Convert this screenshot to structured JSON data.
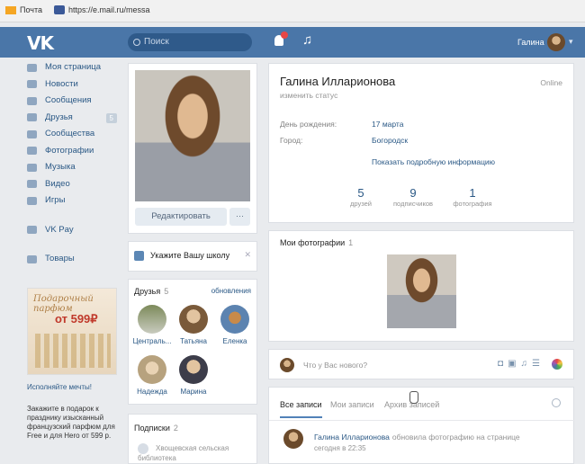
{
  "browser": {
    "tabs": [
      {
        "label": "Почта"
      },
      {
        "label": "https://e.mail.ru/messa"
      }
    ]
  },
  "header": {
    "logo": "VK",
    "search_placeholder": "Поиск",
    "user_name": "Галина",
    "accent_color": "#4a76a8"
  },
  "sidebar": {
    "items": [
      {
        "label": "Моя страница",
        "icon": "home-icon"
      },
      {
        "label": "Новости",
        "icon": "news-icon"
      },
      {
        "label": "Сообщения",
        "icon": "messages-icon"
      },
      {
        "label": "Друзья",
        "icon": "friends-icon",
        "badge": "5"
      },
      {
        "label": "Сообщества",
        "icon": "communities-icon"
      },
      {
        "label": "Фотографии",
        "icon": "photo-icon"
      },
      {
        "label": "Музыка",
        "icon": "music-icon"
      },
      {
        "label": "Видео",
        "icon": "video-icon"
      },
      {
        "label": "Игры",
        "icon": "games-icon"
      }
    ],
    "extra": [
      {
        "label": "VK Pay",
        "icon": "vkpay-icon"
      },
      {
        "label": "Товары",
        "icon": "goods-icon"
      }
    ]
  },
  "ad": {
    "image_text": "Подарочный парфюм",
    "price": "от 599₽",
    "title": "Исполняйте мечты!",
    "text": "Закажите в подарок к празднику изысканный французский парфюм для Free и для Hero от 599 р."
  },
  "profile_left": {
    "edit_label": "Редактировать",
    "more_label": "···",
    "school_prompt": "Укажите Вашу школу",
    "friends_title": "Друзья",
    "friends_count": "5",
    "friends_updates": "обновления",
    "friends": [
      {
        "name": "Централь..."
      },
      {
        "name": "Татьяна"
      },
      {
        "name": "Еленка"
      },
      {
        "name": "Надежда"
      },
      {
        "name": "Марина"
      }
    ],
    "subs_title": "Подписки",
    "subs_count": "2",
    "subs_item": "Хвощевская сельская библиотека"
  },
  "profile": {
    "name": "Галина Илларионова",
    "status_prompt": "изменить статус",
    "online": "Online",
    "birthday_label": "День рождения:",
    "birthday_value": "17 марта",
    "city_label": "Город:",
    "city_value": "Богородск",
    "show_more": "Показать подробную информацию",
    "stats": [
      {
        "num": "5",
        "label": "друзей"
      },
      {
        "num": "9",
        "label": "подписчиков"
      },
      {
        "num": "1",
        "label": "фотография"
      }
    ]
  },
  "photos": {
    "title": "Мои фотографии",
    "count": "1"
  },
  "compose": {
    "placeholder": "Что у Вас нового?"
  },
  "wall": {
    "tabs": [
      "Все записи",
      "Мои записи",
      "Архив записей"
    ],
    "post_author": "Галина Илларионова",
    "post_action": "обновила фотографию на странице",
    "post_time": "сегодня в 22:35"
  }
}
